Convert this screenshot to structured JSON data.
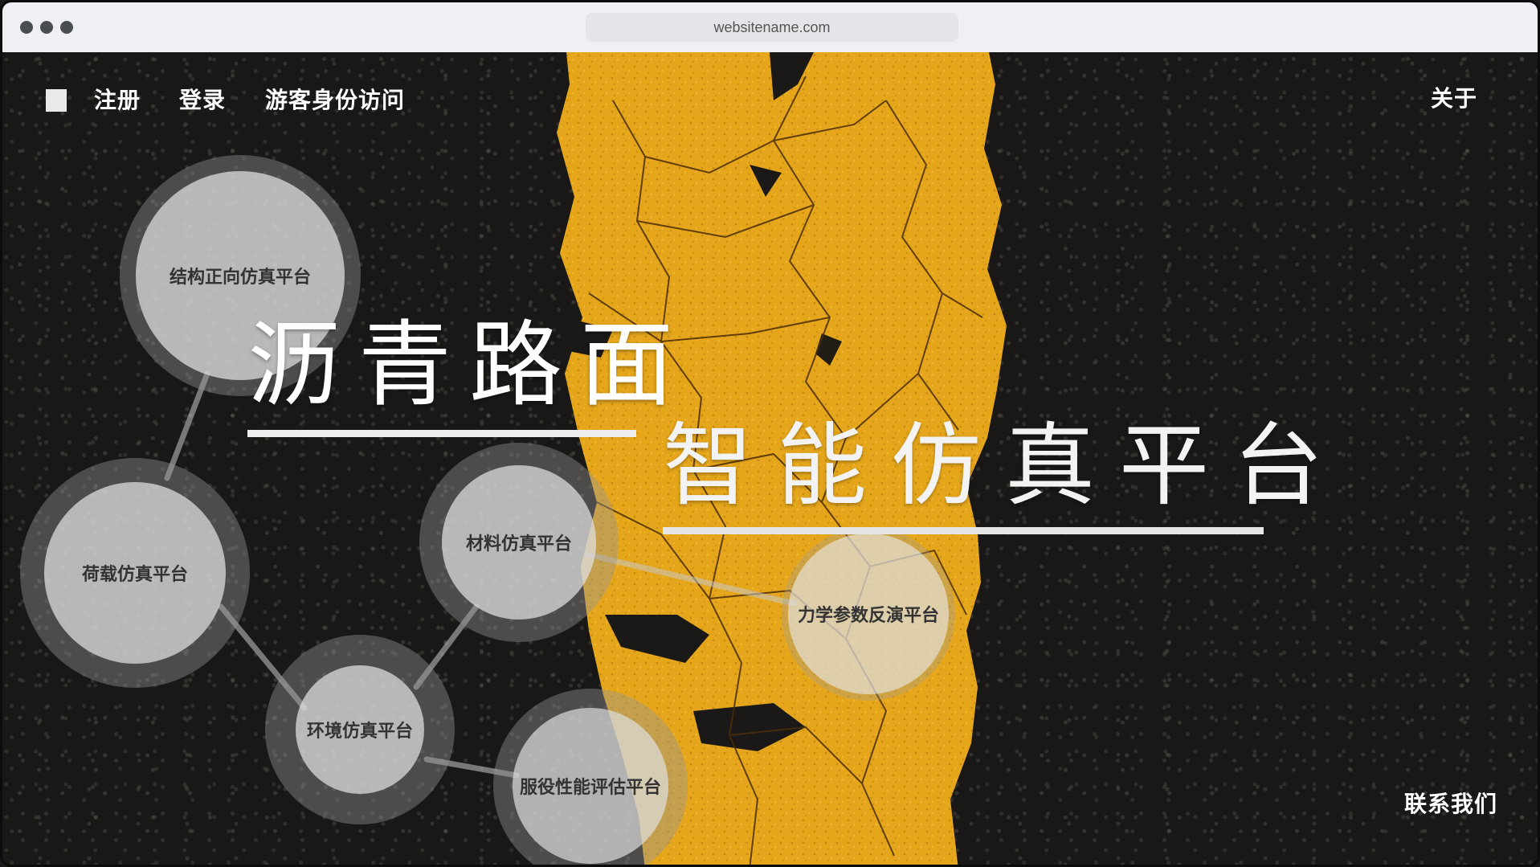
{
  "browser": {
    "url": "websitename.com"
  },
  "nav": {
    "register": "注册",
    "login": "登录",
    "guest": "游客身份访问",
    "about": "关于"
  },
  "hero": {
    "title": "沥青路面",
    "subtitle": "智能仿真平台"
  },
  "platforms": {
    "structure": "结构正向仿真平台",
    "load": "荷载仿真平台",
    "material": "材料仿真平台",
    "mechanics": "力学参数反演平台",
    "environment": "环境仿真平台",
    "service": "服役性能评估平台"
  },
  "footer": {
    "contact": "联系我们"
  },
  "colors": {
    "asphalt": "#191816",
    "road_paint_yellow": "#e8a91c",
    "node_outer": "rgba(150,150,150,0.42)",
    "node_inner": "rgba(222,222,222,0.74)"
  }
}
